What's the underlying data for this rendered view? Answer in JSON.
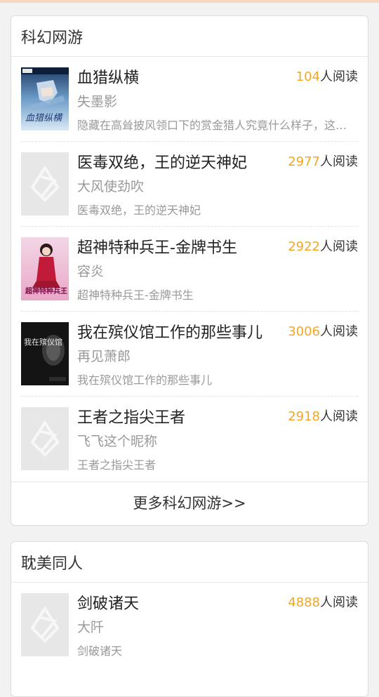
{
  "colors": {
    "accent_orange": "#f5a623",
    "page_background": "#f2f2f2",
    "card_background": "#ffffff",
    "placeholder_cover": "#e7e7e7"
  },
  "reads_suffix": "人阅读",
  "sections": [
    {
      "title": "科幻网游",
      "more_label": "更多科幻网游>>",
      "books": [
        {
          "title": "血猎纵横",
          "author": "失墨影",
          "reads": "104",
          "desc": "隐藏在高耸披风领口下的赏金猎人究竟什么样子，这里会讲述一段热血冒险的故事",
          "cover": "anime-warrior-cover",
          "cover_text": "血猎纵横"
        },
        {
          "title": "医毒双绝，王的逆天神妃",
          "author": "大风使劲吹",
          "reads": "2977",
          "desc": "医毒双绝，王的逆天神妃",
          "cover": "placeholder-cover"
        },
        {
          "title": "超神特种兵王-金牌书生",
          "author": "容炎",
          "reads": "2922",
          "desc": "超神特种兵王-金牌书生",
          "cover": "girl-in-red-cover",
          "cover_text": "超神特种兵王"
        },
        {
          "title": "我在殡仪馆工作的那些事儿",
          "author": "再见萧郎",
          "reads": "3006",
          "desc": "我在殡仪馆工作的那些事儿",
          "cover": "dark-horror-cover",
          "cover_text": "我在殡仪馆"
        },
        {
          "title": "王者之指尖王者",
          "author": "飞飞这个昵称",
          "reads": "2918",
          "desc": "王者之指尖王者",
          "cover": "placeholder-cover"
        }
      ]
    },
    {
      "title": "耽美同人",
      "books": [
        {
          "title": "剑破诸天",
          "author": "大阡",
          "reads": "4888",
          "desc": "剑破诸天",
          "cover": "placeholder-cover"
        }
      ]
    }
  ]
}
